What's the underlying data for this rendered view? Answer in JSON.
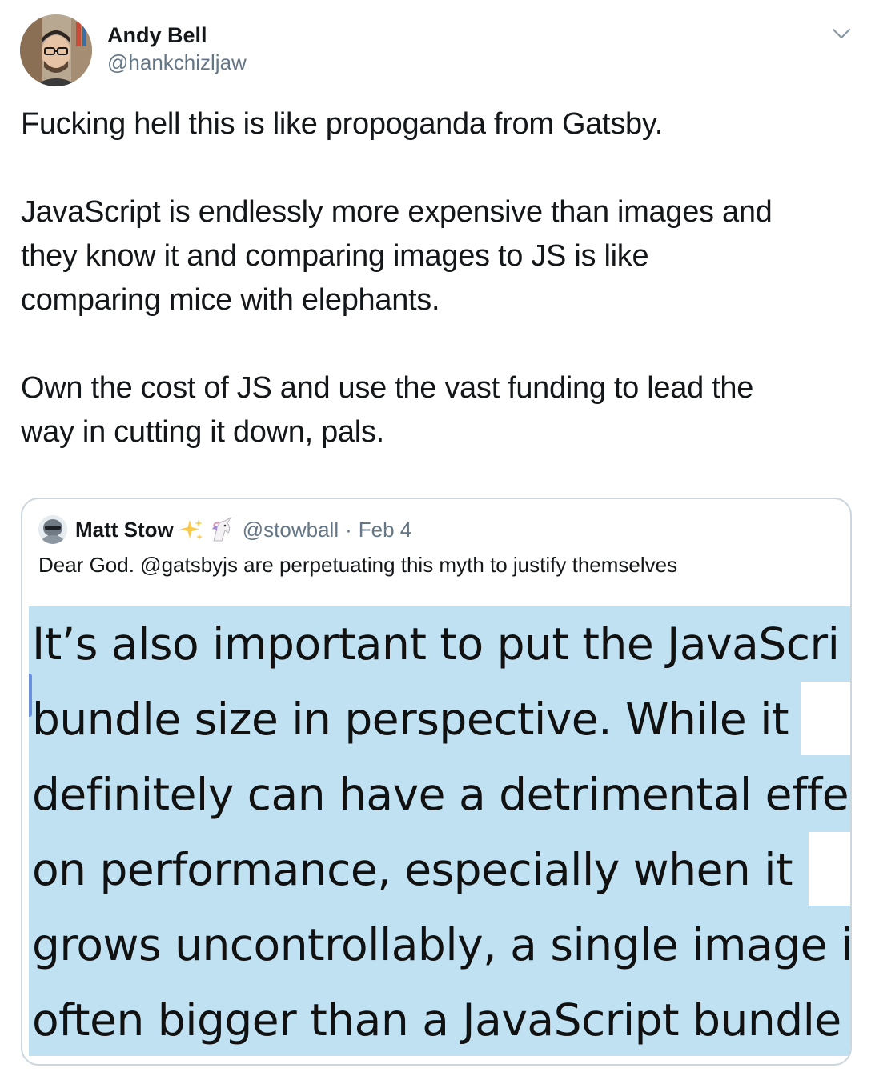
{
  "tweet": {
    "author": {
      "display_name": "Andy Bell",
      "handle": "@hankchizljaw",
      "avatar_icon": "avatar-photo-icon"
    },
    "menu_icon": "chevron-down-icon",
    "paragraphs": [
      "Fucking hell this is like propoganda from Gatsby.",
      "JavaScript is endlessly more expensive than images and\nthey know it and comparing images to JS is like\ncomparing mice with elephants.",
      "Own the cost of JS and use the vast funding to lead the\nway in cutting it down, pals."
    ]
  },
  "quoted_tweet": {
    "author": {
      "display_name": "Matt Stow",
      "emojis": [
        "sparkles-icon",
        "unicorn-icon"
      ],
      "handle": "@stowball",
      "separator": "·",
      "date": "Feb 4"
    },
    "text": "Dear God. @gatsbyjs are perpetuating this myth to justify themselves",
    "media": {
      "background_color": "#bfe1f2",
      "lines": [
        "It’s also important to put the JavaScri",
        "bundle size in perspective. While it",
        "definitely can have a detrimental effe",
        "on performance, especially when it",
        "grows uncontrollably, a single image i",
        "often bigger than a JavaScript bundle"
      ]
    }
  },
  "colors": {
    "text_primary": "#14171a",
    "text_secondary": "#657786",
    "border": "#ccd6dd",
    "highlight": "#bfe1f2"
  }
}
